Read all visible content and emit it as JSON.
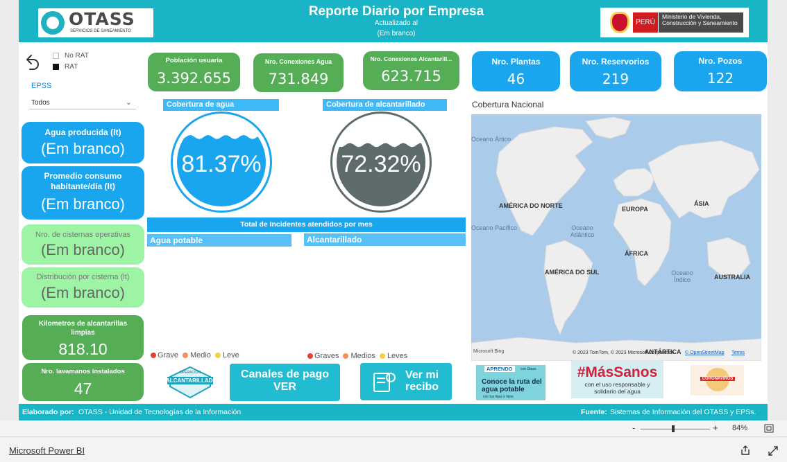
{
  "header": {
    "title": "Reporte Diario por Empresa",
    "updated_label": "Actualizado al",
    "updated_value": "(Em branco)",
    "otass_logo_text": "OTASS",
    "otass_logo_sub": "SERVICIOS DE SANEAMIENTO",
    "ministry_peru": "PERÚ",
    "ministry_name": "Ministerio de Vivienda, Construcción y Saneamiento"
  },
  "filters": {
    "legend": [
      {
        "label": "No RAT",
        "color": "#ffffff"
      },
      {
        "label": "RAT",
        "color": "#111111"
      }
    ],
    "epss_label": "EPSS",
    "epss_value": "Todos"
  },
  "kpis_top": [
    {
      "label": "Población usuaria",
      "value": "3.392.655"
    },
    {
      "label": "Nro. Conexiones Agua",
      "value": "731.849"
    },
    {
      "label": "Nro. Conexiones Alcantarill...",
      "value": "623.715"
    }
  ],
  "kpis_infra": [
    {
      "label": "Nro. Plantas",
      "value": "46"
    },
    {
      "label": "Nro. Reservorios",
      "value": "219"
    },
    {
      "label": "Nro. Pozos",
      "value": "122"
    }
  ],
  "kpis_left": [
    {
      "label": "Agua producida (lt)",
      "value": "(Em branco)"
    },
    {
      "label": "Promedio consumo habitante/día (lt)",
      "value": "(Em branco)"
    },
    {
      "label": "Nro. de cisternas operativas",
      "value": "(Em branco)"
    },
    {
      "label": "Distribución por cisterna (lt)",
      "value": "(Em branco)"
    },
    {
      "label": "Kilometros de alcantarillas limpias",
      "value": "818.10"
    },
    {
      "label": "Nro. lavamanos instalados",
      "value": "47"
    }
  ],
  "gauges": [
    {
      "title": "Cobertura de agua",
      "value": "81.37%",
      "fraction": 0.8137,
      "color": "#1aa6ee"
    },
    {
      "title": "Cobertura de alcantarillado",
      "value": "72.32%",
      "fraction": 0.7232,
      "color": "#5e6b6b"
    }
  ],
  "incidents": {
    "title": "Total de Incidentes atendidos por mes",
    "left_title": "Agua potable",
    "right_title": "Alcantarillado",
    "left_legend": [
      {
        "label": "Grave",
        "color": "#e8402e"
      },
      {
        "label": "Medio",
        "color": "#f2915c"
      },
      {
        "label": "Leve",
        "color": "#f4cf3e"
      }
    ],
    "right_legend": [
      {
        "label": "Graves",
        "color": "#e8402e"
      },
      {
        "label": "Medios",
        "color": "#f2915c"
      },
      {
        "label": "Leves",
        "color": "#f4cf3e"
      }
    ]
  },
  "map": {
    "title": "Cobertura Nacional",
    "labels": [
      "AMÉRICA DO NORTE",
      "EUROPA",
      "ÁSIA",
      "ÁFRICA",
      "AMÉRICA DO SUL",
      "AUSTRALIA",
      "ANTÁRTICA"
    ],
    "oceans": [
      "Oceano Atlântico",
      "Oceano Índico",
      "Oceano Ártico",
      "Oceano Pacífico"
    ],
    "bing": "Microsoft Bing",
    "copyright": "© 2023 TomTom, © 2023 Microsoft Corporation",
    "osm": "© OpenStreetMap",
    "terms": "Terms"
  },
  "buttons": {
    "alcantarillado_badge": "ALCANTARILLADO",
    "alcantarillado_top": "OPERACIÓN",
    "canales_line1": "Canales de pago",
    "canales_line2": "VER",
    "recibo_line1": "Ver mi",
    "recibo_line2": "recibo",
    "aprendo_tag": "APRENDO",
    "aprendo_with": "con Otass",
    "aprendo_main": "Conoce la ruta del agua potable",
    "aprendo_sub": "con tus hijas e hijos",
    "massanos_title": "#MásSanos",
    "massanos_sub": "con el uso responsable y solidario del agua",
    "corona_label": "CORONAVIRUS"
  },
  "footer": {
    "left_label": "Elaborado por:",
    "left_value": "OTASS - Unidad de Tecnologías de la Información",
    "right_label": "Fuente:",
    "right_value": "Sistemas de Información del OTASS y EPSs."
  },
  "chrome": {
    "zoom_minus": "-",
    "zoom_plus": "+",
    "zoom_level": "84%",
    "zoom_fraction": 0.84,
    "app_name": "Microsoft Power BI"
  }
}
